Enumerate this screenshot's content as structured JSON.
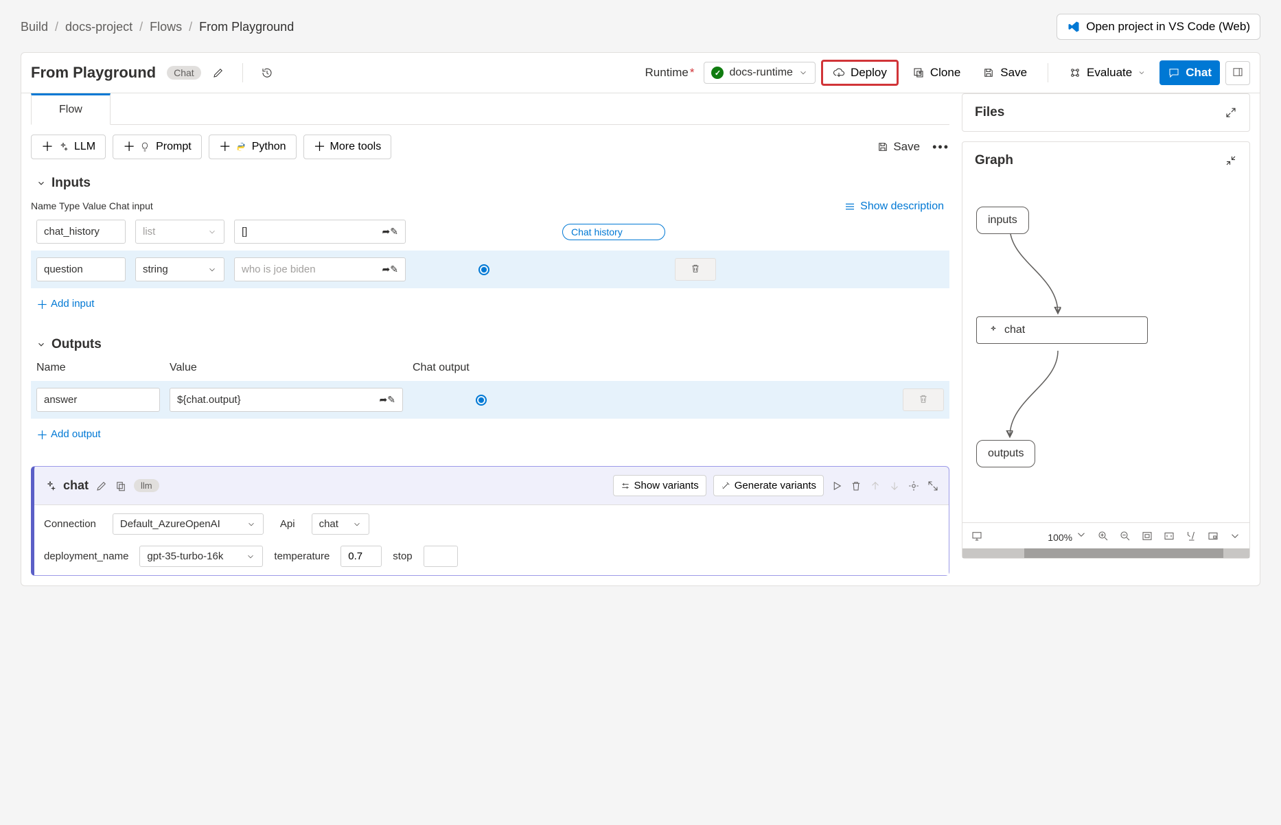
{
  "breadcrumb": {
    "root": "Build",
    "project": "docs-project",
    "section": "Flows",
    "current": "From Playground"
  },
  "vscode_button": "Open project in VS Code (Web)",
  "header": {
    "title": "From Playground",
    "badge": "Chat",
    "runtime_label": "Runtime",
    "runtime_value": "docs-runtime",
    "deploy": "Deploy",
    "clone": "Clone",
    "save": "Save",
    "evaluate": "Evaluate",
    "chat": "Chat"
  },
  "tab": {
    "flow": "Flow"
  },
  "tools": {
    "llm": "LLM",
    "prompt": "Prompt",
    "python": "Python",
    "more": "More tools",
    "save": "Save"
  },
  "inputs": {
    "title": "Inputs",
    "cols": {
      "name": "Name",
      "type": "Type",
      "value": "Value",
      "chat_input": "Chat input"
    },
    "show_desc": "Show description",
    "rows": [
      {
        "name": "chat_history",
        "type": "list",
        "value": "[]",
        "chip": "Chat history",
        "is_chat_input": false
      },
      {
        "name": "question",
        "type": "string",
        "value": "",
        "placeholder": "who is joe biden",
        "is_chat_input": true
      }
    ],
    "add": "Add input"
  },
  "outputs": {
    "title": "Outputs",
    "cols": {
      "name": "Name",
      "value": "Value",
      "chat_output": "Chat output"
    },
    "rows": [
      {
        "name": "answer",
        "value": "${chat.output}",
        "is_chat_output": true
      }
    ],
    "add": "Add output"
  },
  "chat_node": {
    "name": "chat",
    "tag": "llm",
    "show_variants": "Show variants",
    "gen_variants": "Generate variants",
    "connection_label": "Connection",
    "connection_value": "Default_AzureOpenAI",
    "api_label": "Api",
    "api_value": "chat",
    "deployment_label": "deployment_name",
    "deployment_value": "gpt-35-turbo-16k",
    "temperature_label": "temperature",
    "temperature_value": "0.7",
    "stop_label": "stop"
  },
  "right": {
    "files": "Files",
    "graph": "Graph",
    "nodes": {
      "inputs": "inputs",
      "chat": "chat",
      "outputs": "outputs"
    },
    "zoom": "100%"
  }
}
